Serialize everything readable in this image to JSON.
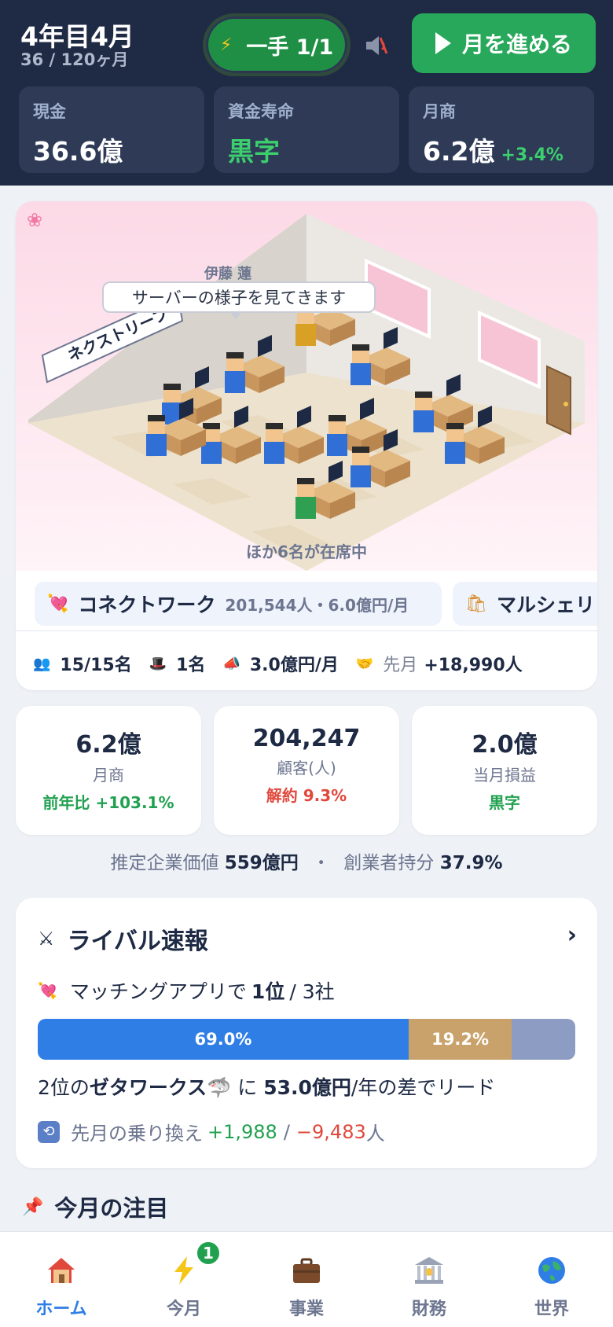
{
  "header": {
    "date": "4年目4月",
    "months": "36 / 120ヶ月",
    "turn_button": "一手 1/1",
    "advance_button": "月を進める",
    "stats": [
      {
        "label": "現金",
        "value": "36.6億"
      },
      {
        "label": "資金寿命",
        "value": "黒字"
      },
      {
        "label": "月商",
        "value": "6.2億",
        "delta": "+3.4%"
      }
    ]
  },
  "office": {
    "company_sign": "ネクストリープ",
    "ceo_name": "伊藤 蓮",
    "speech": "サーバーの様子を見てきます",
    "others": "ほか6名が在席中"
  },
  "businesses": [
    {
      "icon": "heart-arrow-icon",
      "name": "コネクトワーク",
      "meta": "201,544人・6.0億円/月"
    },
    {
      "icon": "shopping-bag-icon",
      "name": "マルシェリ",
      "meta": ""
    }
  ],
  "company_meta": {
    "staff": "15/15名",
    "executives": "1名",
    "ad_spend": "3.0億円/月",
    "last_month_label": "先月",
    "last_month_value": "+18,990人"
  },
  "kpis": [
    {
      "value": "6.2億",
      "label": "月商",
      "sub": "前年比 +103.1%",
      "tone": "green"
    },
    {
      "value": "204,247",
      "label": "顧客(人)",
      "sub": "解約 9.3%",
      "tone": "red"
    },
    {
      "value": "2.0億",
      "label": "当月損益",
      "sub": "黒字",
      "tone": "green"
    }
  ],
  "valuation": {
    "label1": "推定企業価値",
    "value1": "559億円",
    "sep": "・",
    "label2": "創業者持分",
    "value2": "37.9%"
  },
  "rival": {
    "title": "ライバル速報",
    "chevron": "›",
    "rank_prefix": "マッチングアプリで",
    "rank_value": "1位",
    "rank_suffix": "/ 3社",
    "shares": [
      {
        "label": "69.0%",
        "value": 69.0,
        "color": "#2f7ee6"
      },
      {
        "label": "19.2%",
        "value": 19.2,
        "color": "#c9a26b"
      },
      {
        "label": "",
        "value": 11.8,
        "color": "#8d9cc2"
      }
    ],
    "lead_prefix": "2位の",
    "lead_rival": "ゼタワークス",
    "lead_mid": "に",
    "lead_amount": "53.0億円",
    "lead_suffix": "/年の差でリード",
    "switch_label": "先月の乗り換え",
    "switch_in": "+1,988",
    "switch_sep": "/",
    "switch_out": "−9,483",
    "switch_unit": "人"
  },
  "focus": {
    "title": "今月の注目"
  },
  "tabs": [
    {
      "label": "ホーム",
      "icon": "house-icon"
    },
    {
      "label": "今月",
      "icon": "lightning-icon",
      "badge": "1"
    },
    {
      "label": "事業",
      "icon": "briefcase-icon"
    },
    {
      "label": "財務",
      "icon": "bank-icon"
    },
    {
      "label": "世界",
      "icon": "globe-icon"
    }
  ]
}
